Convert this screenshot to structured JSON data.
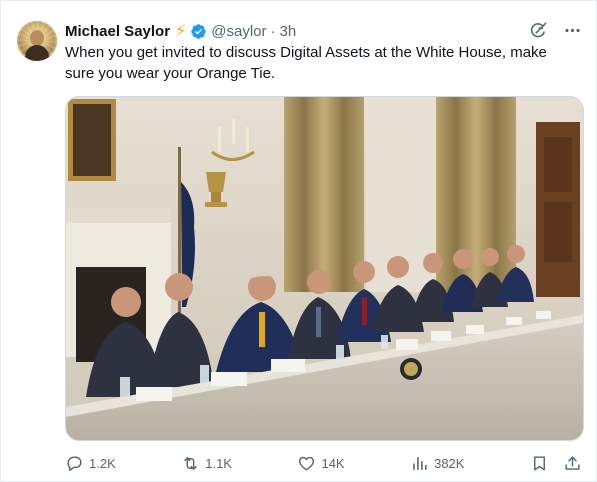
{
  "author": {
    "name": "Michael Saylor",
    "badge_emoji": "⚡",
    "handle": "@saylor",
    "separator": "·",
    "time": "3h"
  },
  "tweet": {
    "text": "When you get invited to discuss Digital Assets at the White House, make sure you wear your Orange Tie."
  },
  "metrics": {
    "replies": "1.2K",
    "reposts": "1.1K",
    "likes": "14K",
    "views": "382K"
  },
  "icons": {
    "reply": "reply-icon",
    "repost": "repost-icon",
    "like": "heart-icon",
    "views": "views-chart-icon",
    "bookmark": "bookmark-icon",
    "share": "share-icon",
    "grok": "grok-icon",
    "more": "more-dots-icon",
    "verified": "verified-badge-icon"
  },
  "colors": {
    "verified_blue": "#1d9bf0",
    "text_primary": "#0f1419",
    "text_secondary": "#536471",
    "bolt_orange": "#f2a900"
  }
}
